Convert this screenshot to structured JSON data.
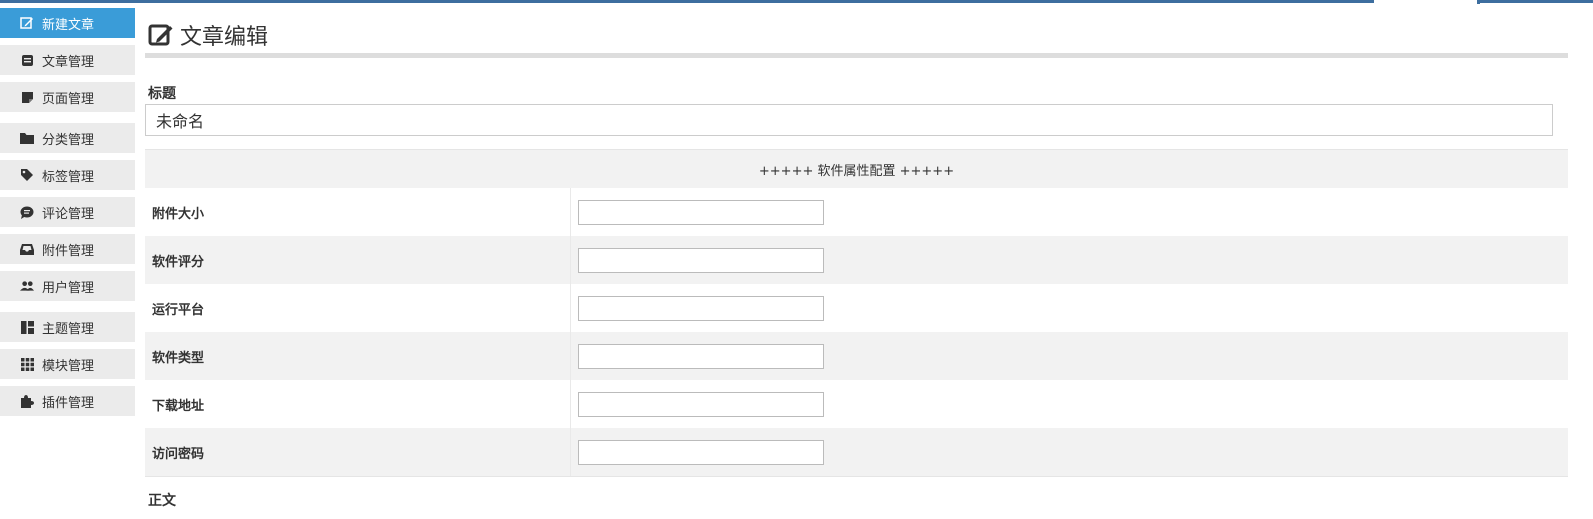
{
  "sidebar": {
    "items": [
      {
        "label": "新建文章",
        "icon": "edit-icon",
        "active": true
      },
      {
        "label": "文章管理",
        "icon": "article-icon"
      },
      {
        "label": "页面管理",
        "icon": "page-icon"
      },
      {
        "label": "分类管理",
        "icon": "folder-icon"
      },
      {
        "label": "标签管理",
        "icon": "tag-icon"
      },
      {
        "label": "评论管理",
        "icon": "comment-icon"
      },
      {
        "label": "附件管理",
        "icon": "inbox-icon"
      },
      {
        "label": "用户管理",
        "icon": "users-icon"
      },
      {
        "label": "主题管理",
        "icon": "layout-icon"
      },
      {
        "label": "模块管理",
        "icon": "grid-icon"
      },
      {
        "label": "插件管理",
        "icon": "puzzle-icon"
      }
    ]
  },
  "main": {
    "page_title": "文章编辑",
    "title_field": {
      "label": "标题",
      "value": "未命名"
    },
    "props_header": "+++++ 软件属性配置 +++++",
    "props": [
      {
        "label": "附件大小",
        "value": ""
      },
      {
        "label": "软件评分",
        "value": ""
      },
      {
        "label": "运行平台",
        "value": ""
      },
      {
        "label": "软件类型",
        "value": ""
      },
      {
        "label": "下载地址",
        "value": ""
      },
      {
        "label": "访问密码",
        "value": ""
      }
    ],
    "body_label": "正文"
  },
  "colors": {
    "accent": "#3a9cd8",
    "topbar": "#3d6e9f",
    "sidebar_bg": "#ebebeb"
  }
}
